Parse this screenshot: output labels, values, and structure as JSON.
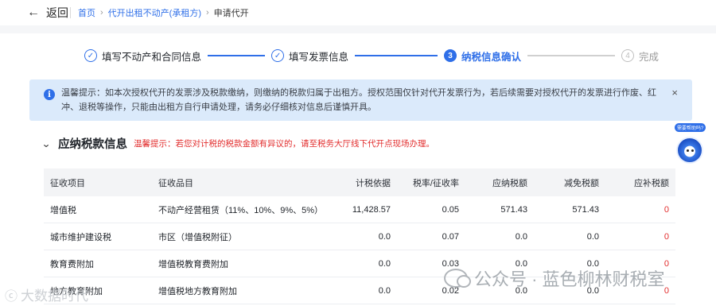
{
  "header": {
    "back_label": "返回",
    "breadcrumb": [
      "首页",
      "代开出租不动产(承租方)",
      "申请代开"
    ]
  },
  "steps": [
    {
      "label": "填写不动产和合同信息",
      "marker": "✓",
      "state": "done"
    },
    {
      "label": "填写发票信息",
      "marker": "✓",
      "state": "done"
    },
    {
      "label": "纳税信息确认",
      "marker": "3",
      "state": "active"
    },
    {
      "label": "完成",
      "marker": "4",
      "state": "todo"
    }
  ],
  "notice": {
    "icon": "info-icon",
    "text": "温馨提示：如本次授权代开的发票涉及税款缴纳，则缴纳的税款归属于出租方。授权范围仅针对代开发票行为，若后续需要对授权代开的发票进行作废、红冲、退税等操作，只能由出租方自行申请处理，请务必仔细核对信息后谨慎开具。",
    "close": "×"
  },
  "section": {
    "title": "应纳税款信息",
    "tip": "温馨提示：若您对计税的税款金额有异议的，请至税务大厅线下代开点现场办理。"
  },
  "table": {
    "columns": [
      "征收项目",
      "征收品目",
      "计税依据",
      "税率/征收率",
      "应纳税额",
      "减免税额",
      "应补税额"
    ],
    "rows": [
      [
        "增值税",
        "不动产经营租赁（11%、10%、9%、5%）",
        "11,428.57",
        "0.05",
        "571.43",
        "571.43",
        "0"
      ],
      [
        "城市维护建设税",
        "市区（增值税附征）",
        "0.0",
        "0.07",
        "0.0",
        "0.0",
        "0"
      ],
      [
        "教育费附加",
        "增值税教育费附加",
        "0.0",
        "0.03",
        "0.0",
        "0.0",
        "0"
      ],
      [
        "地方教育附加",
        "增值税地方教育附加",
        "0.0",
        "0.02",
        "0.0",
        "0.0",
        "0"
      ]
    ]
  },
  "assistant": {
    "bubble": "需要帮助吗?"
  },
  "watermarks": {
    "right": "公众号 · 蓝色柳林财税室",
    "left": "大数据时代"
  },
  "colors": {
    "accent": "#2f6fe8",
    "warning": "#e22d2d",
    "notice_bg": "#dbeafb"
  }
}
